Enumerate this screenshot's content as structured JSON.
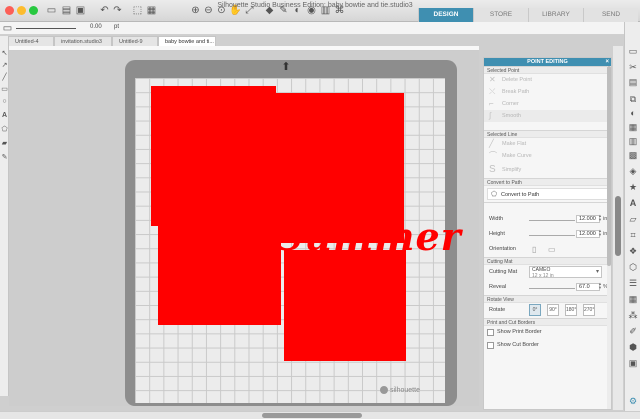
{
  "window": {
    "title": "Silhouette Studio Business Edition: baby bowtie and tie.studio3"
  },
  "nav_tabs": [
    {
      "label": "DESIGN",
      "active": true
    },
    {
      "label": "STORE",
      "active": false
    },
    {
      "label": "LIBRARY",
      "active": false
    },
    {
      "label": "SEND",
      "active": false
    }
  ],
  "toolbar": {
    "line_width_value": "0.00",
    "line_width_unit": "pt"
  },
  "doc_tabs": [
    {
      "label": "Untitled-4",
      "active": false
    },
    {
      "label": "invitation.studio3",
      "active": false
    },
    {
      "label": "Untitled-9",
      "active": false
    },
    {
      "label": "baby bowtie and ti...",
      "active": true
    }
  ],
  "canvas": {
    "design_text": "Summer",
    "design_color": "#ff0000",
    "mat_logo": "silhouette"
  },
  "panel": {
    "title": "POINT EDITING",
    "selected_point": {
      "title": "Selected Point",
      "items": [
        {
          "label": "Delete Point",
          "icon": "delete-point-icon",
          "selected": false
        },
        {
          "label": "Break Path",
          "icon": "break-path-icon",
          "selected": false
        },
        {
          "label": "Corner",
          "icon": "corner-icon",
          "selected": false
        },
        {
          "label": "Smooth",
          "icon": "smooth-icon",
          "selected": true
        }
      ]
    },
    "selected_line": {
      "title": "Selected Line",
      "items": [
        {
          "label": "Make Flat",
          "icon": "make-flat-icon"
        },
        {
          "label": "Make Curve",
          "icon": "make-curve-icon"
        },
        {
          "label": "Simplify",
          "icon": "simplify-icon"
        }
      ]
    },
    "convert": {
      "title": "Convert to Path",
      "button_label": "Convert to Path"
    },
    "size": {
      "width_label": "Width",
      "width_value": "12.000",
      "height_label": "Height",
      "height_value": "12.000",
      "unit": "in",
      "orientation_label": "Orientation"
    },
    "cutting_mat": {
      "title": "Cutting Mat",
      "label": "Cutting Mat",
      "mat_name": "CAMEO",
      "mat_size": "12 x 12 in",
      "reveal_label": "Reveal",
      "reveal_value": "67.0",
      "reveal_unit": "%"
    },
    "rotate_view": {
      "title": "Rotate View",
      "label": "Rotate",
      "options": [
        "0°",
        "90°",
        "180°",
        "270°"
      ]
    },
    "borders": {
      "title": "Print and Cut Borders",
      "show_print_border": "Show Print Border",
      "show_cut_border": "Show Cut Border"
    }
  }
}
